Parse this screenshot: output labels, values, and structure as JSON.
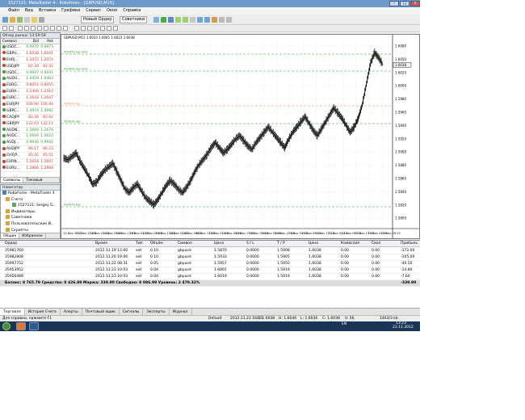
{
  "window": {
    "title": "1527121: MetaTrader 4 - Roboforex - [GBPUSD,M15]",
    "controls": [
      "–",
      "□",
      "×"
    ]
  },
  "menu": [
    "Файл",
    "Вид",
    "Вставка",
    "Графики",
    "Сервис",
    "Окно",
    "Справка"
  ],
  "toolbar": {
    "new_order": "Новый Ордер",
    "expert": "Советники"
  },
  "market_watch": {
    "title": "Обзор рынка: 13:59:58",
    "columns": [
      "Символ",
      "Bid",
      "Ask"
    ],
    "rows": [
      {
        "symbol": "USDC...",
        "bid": "0.9970",
        "ask": "0.9973",
        "color": "#3a9a3a"
      },
      {
        "symbol": "GBPU...",
        "bid": "1.6038",
        "ask": "1.6041",
        "color": "#d03a2a"
      },
      {
        "symbol": "EURJ...",
        "bid": "1.2072",
        "ask": "1.2074",
        "color": "#d03a2a"
      },
      {
        "symbol": "USDJPY",
        "bid": "82.39",
        "ask": "82.42",
        "color": "#d03a2a"
      },
      {
        "symbol": "USDC...",
        "bid": "0.9927",
        "ask": "0.9931",
        "color": "#3a9a3a"
      },
      {
        "symbol": "AUDU...",
        "bid": "1.0459",
        "ask": "1.0463",
        "color": "#3a9a3a"
      },
      {
        "symbol": "EURG...",
        "bid": "0.8053",
        "ask": "0.8055",
        "color": "#d03a2a"
      },
      {
        "symbol": "EURA...",
        "bid": "1.2406",
        "ask": "1.2410",
        "color": "#d03a2a"
      },
      {
        "symbol": "EURC...",
        "bid": "1.2643",
        "ask": "1.2647",
        "color": "#d03a2a"
      },
      {
        "symbol": "EURJPY",
        "bid": "106.90",
        "ask": "106.94",
        "color": "#d03a2a"
      },
      {
        "symbol": "GBPC...",
        "bid": "1.4974",
        "ask": "1.4982",
        "color": "#3a9a3a"
      },
      {
        "symbol": "CADJPY",
        "bid": "82.56",
        "ask": "82.62",
        "color": "#d03a2a"
      },
      {
        "symbol": "GBPJPY",
        "bid": "132.03",
        "ask": "132.11",
        "color": "#d03a2a"
      },
      {
        "symbol": "AUDN...",
        "bid": "1.2669",
        "ask": "1.2678",
        "color": "#3a9a3a"
      },
      {
        "symbol": "AUDC...",
        "bid": "1.0604",
        "ask": "1.0610",
        "color": "#3a9a3a"
      },
      {
        "symbol": "AUDJ...",
        "bid": "0.9936",
        "ask": "0.9942",
        "color": "#3a9a3a"
      },
      {
        "symbol": "AUDJPY",
        "bid": "86.17",
        "ask": "86.23",
        "color": "#d03a2a"
      },
      {
        "symbol": "CHFJP...",
        "bid": "85.45",
        "ask": "85.51",
        "color": "#d03a2a"
      },
      {
        "symbol": "EURN...",
        "bid": "1.5654",
        "ask": "1.5667",
        "color": "#d03a2a"
      },
      {
        "symbol": "EURU...",
        "bid": "1.2866",
        "ask": "1.2868",
        "color": "#d03a2a"
      }
    ],
    "tabs": [
      "Символы",
      "Тиковый график"
    ]
  },
  "navigator": {
    "title": "Навигатор",
    "items": [
      "RoboForex - MetaTrader 4",
      "Счета",
      "1527121: Sergey G...",
      "Индикаторы",
      "Советники",
      "Пользовательские И...",
      "Скрипты"
    ],
    "tabs": [
      "Общие",
      "Избранное"
    ]
  },
  "chart": {
    "header": "GBPUSD,M15  1.6033 1.6041 1.6023 1.6038",
    "tab": "GBPUSD,M15",
    "price_labels": [
      "1.6080",
      "1.6050",
      "1.6020",
      "1.6000",
      "1.5980",
      "1.5960",
      "1.5940",
      "1.5920",
      "1.5900",
      "1.5880",
      "1.5860",
      "1.5840",
      "1.5820",
      "1.5800"
    ],
    "price_marker": "1.6038",
    "time_labels": [
      "13 Nov 2012",
      "13 Nov 17:45",
      "14 Nov 01:45",
      "14 Nov 09:45",
      "14 Nov 17:45",
      "15 Nov 01:45",
      "15 Nov 09:45",
      "15 Nov 17:45",
      "16 Nov 01:45",
      "16 Nov 09:45",
      "16 Nov 17:45",
      "19 Nov 01:45",
      "19 Nov 09:45",
      "19 Nov 17:45",
      "20 Nov 01:45",
      "20 Nov 09:45",
      "20 Nov 17:45",
      "21 Nov 01:45",
      "21 Nov 09:15",
      "21 Nov 17:15",
      "22 Nov 01:15",
      "22 Nov 09:15",
      "22 Nov 17:15",
      "23 Nov 01:15",
      "23 Nov 09:15"
    ],
    "level_labels": [
      "#33950 buy limit",
      "#33969 buy limit",
      "#33924 buy",
      "#33924 sell",
      "#33970 buy"
    ]
  },
  "chart_data": {
    "type": "line",
    "series": [
      {
        "values": [
          0.37,
          0.36,
          0.38,
          0.4,
          0.35,
          0.31,
          0.27,
          0.22,
          0.23,
          0.27,
          0.3,
          0.32,
          0.34,
          0.29,
          0.24,
          0.19,
          0.17,
          0.2,
          0.22,
          0.18,
          0.14,
          0.12,
          0.1,
          0.13,
          0.17,
          0.21,
          0.24,
          0.22,
          0.19,
          0.17,
          0.2,
          0.24,
          0.29,
          0.33,
          0.36,
          0.39,
          0.43,
          0.46,
          0.43,
          0.4,
          0.42,
          0.45,
          0.48,
          0.5,
          0.47,
          0.44,
          0.42,
          0.46,
          0.49,
          0.52,
          0.55,
          0.52,
          0.49,
          0.46,
          0.43,
          0.48,
          0.52,
          0.55,
          0.58,
          0.61,
          0.57,
          0.53,
          0.5,
          0.54,
          0.58,
          0.62,
          0.66,
          0.63,
          0.6,
          0.56,
          0.52,
          0.55,
          0.6,
          0.68,
          0.8,
          0.92,
          0.98,
          0.95,
          0.91
        ]
      }
    ],
    "ylim": [
      0,
      1
    ]
  },
  "terminal": {
    "columns": [
      "Ордер",
      "Время",
      "Тип",
      "Объём",
      "Символ",
      "Цена",
      "S / L",
      "T / P",
      "Цена",
      "Комиссия",
      "Своп",
      "Прибыль"
    ],
    "rows": [
      [
        "35981769",
        "2012.11.19 13:00",
        "sell",
        "0.10",
        "gbpusd",
        "1.5870",
        "0.0000",
        "1.5908",
        "1.6038",
        "0.00",
        "0.00",
        "-172.00"
      ],
      [
        "35982808",
        "2012.11.20 19:06",
        "sell",
        "0.10",
        "gbpusd",
        "1.5933",
        "0.0000",
        "1.5905",
        "1.6038",
        "0.00",
        "0.00",
        "-105.00"
      ],
      [
        "35997752",
        "2012.11.22 08:31",
        "sell",
        "0.05",
        "gbpusd",
        "1.5957",
        "0.0000",
        "1.5950",
        "1.6038",
        "0.00",
        "0.00",
        "-40.50"
      ],
      [
        "35953952",
        "2012.11.23 10:03",
        "sell",
        "0.04",
        "gbpusd",
        "1.6001",
        "0.0000",
        "1.5919",
        "1.6038",
        "0.00",
        "0.00",
        "-14.80"
      ],
      [
        "35956489",
        "2012.11.23 10:03",
        "sell",
        "0.04",
        "gbpusd",
        "1.6019",
        "0.0000",
        "1.5919",
        "1.6038",
        "0.00",
        "0.00",
        "-7.60"
      ]
    ],
    "balance_line": "Баланс: 8 765.79  Средства: 8 426.89  Маржа: 339.90  Свободно: 8 086.99  Уровень: 2 479.32%",
    "balance_profit": "-339.90",
    "tabs": [
      "Торговля",
      "История Счета",
      "Алерты",
      "Почтовый ящик",
      "Сигналы",
      "Эксперты",
      "Журнал"
    ]
  },
  "statusbar": {
    "help": "Для справки, нажмите F1",
    "profile": "Default",
    "datetime": "2012.11.23 16:15",
    "open": "O: 1.6038",
    "high": "H: 1.6046",
    "low": "L: 1.6036",
    "close": "C: 1.6038",
    "volume": "V: 56",
    "traffic": "1463/3 kb"
  },
  "taskbar": {
    "lang": "EN",
    "time": "13:23",
    "date": "23.11.2012"
  }
}
